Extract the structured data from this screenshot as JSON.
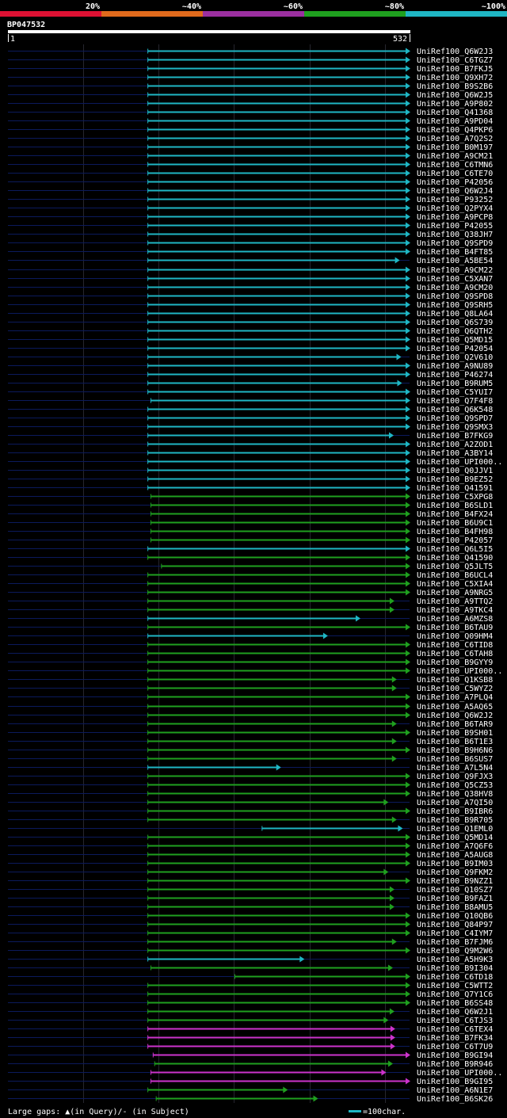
{
  "header": {
    "legend": [
      {
        "label": "20%",
        "color": "#dd1133"
      },
      {
        "label": "~40%",
        "color": "#e06a1c"
      },
      {
        "label": "~60%",
        "color": "#9b2fa0"
      },
      {
        "label": "~80%",
        "color": "#1fa01f"
      },
      {
        "label": "~100%",
        "color": "#1fb6c4"
      }
    ],
    "query_id": "BP047532",
    "start_label": "1",
    "end_label": "532"
  },
  "footer": {
    "gaps_text": "Large gaps: ▲(in Query)/- (in Subject)",
    "scale_text": "=100char."
  },
  "chart_data": {
    "type": "alignment",
    "query_length": 532,
    "colors": {
      "cyan": "#1fb6c4",
      "green": "#1fa01f",
      "magenta": "#cc33cc",
      "navy": "#0b1a5c"
    },
    "hits": [
      {
        "id": "UniRef100_Q6W2J3",
        "start": 186,
        "end": 532,
        "color": "cyan"
      },
      {
        "id": "UniRef100_C6TGZ7",
        "start": 186,
        "end": 532,
        "color": "cyan"
      },
      {
        "id": "UniRef100_B7FKJ5",
        "start": 186,
        "end": 532,
        "color": "cyan"
      },
      {
        "id": "UniRef100_Q9XH72",
        "start": 186,
        "end": 532,
        "color": "cyan"
      },
      {
        "id": "UniRef100_B9S2B6",
        "start": 186,
        "end": 532,
        "color": "cyan"
      },
      {
        "id": "UniRef100_Q6W2J5",
        "start": 186,
        "end": 532,
        "color": "cyan"
      },
      {
        "id": "UniRef100_A9P802",
        "start": 186,
        "end": 532,
        "color": "cyan"
      },
      {
        "id": "UniRef100_Q41368",
        "start": 186,
        "end": 532,
        "color": "cyan"
      },
      {
        "id": "UniRef100_A9PD04",
        "start": 186,
        "end": 532,
        "color": "cyan"
      },
      {
        "id": "UniRef100_Q4PKP6",
        "start": 186,
        "end": 532,
        "color": "cyan"
      },
      {
        "id": "UniRef100_A7Q2S2",
        "start": 186,
        "end": 532,
        "color": "cyan"
      },
      {
        "id": "UniRef100_B0M197",
        "start": 186,
        "end": 532,
        "color": "cyan"
      },
      {
        "id": "UniRef100_A9CM21",
        "start": 186,
        "end": 532,
        "color": "cyan"
      },
      {
        "id": "UniRef100_C6TMN6",
        "start": 186,
        "end": 532,
        "color": "cyan"
      },
      {
        "id": "UniRef100_C6TE70",
        "start": 186,
        "end": 532,
        "color": "cyan"
      },
      {
        "id": "UniRef100_P42056",
        "start": 186,
        "end": 532,
        "color": "cyan"
      },
      {
        "id": "UniRef100_Q6W2J4",
        "start": 186,
        "end": 532,
        "color": "cyan"
      },
      {
        "id": "UniRef100_P93252",
        "start": 186,
        "end": 532,
        "color": "cyan"
      },
      {
        "id": "UniRef100_Q2PYX4",
        "start": 186,
        "end": 532,
        "color": "cyan"
      },
      {
        "id": "UniRef100_A9PCP8",
        "start": 186,
        "end": 532,
        "color": "cyan"
      },
      {
        "id": "UniRef100_P42055",
        "start": 186,
        "end": 532,
        "color": "cyan"
      },
      {
        "id": "UniRef100_Q38JH7",
        "start": 186,
        "end": 532,
        "color": "cyan"
      },
      {
        "id": "UniRef100_Q9SPD9",
        "start": 186,
        "end": 532,
        "color": "cyan"
      },
      {
        "id": "UniRef100_B4FT85",
        "start": 186,
        "end": 532,
        "color": "cyan"
      },
      {
        "id": "UniRef100_A5BE54",
        "start": 186,
        "end": 518,
        "color": "cyan"
      },
      {
        "id": "UniRef100_A9CM22",
        "start": 186,
        "end": 532,
        "color": "cyan"
      },
      {
        "id": "UniRef100_C5XAN7",
        "start": 186,
        "end": 532,
        "color": "cyan"
      },
      {
        "id": "UniRef100_A9CM20",
        "start": 186,
        "end": 532,
        "color": "cyan"
      },
      {
        "id": "UniRef100_Q9SPD8",
        "start": 186,
        "end": 532,
        "color": "cyan"
      },
      {
        "id": "UniRef100_Q9SRH5",
        "start": 186,
        "end": 532,
        "color": "cyan"
      },
      {
        "id": "UniRef100_Q8LA64",
        "start": 186,
        "end": 532,
        "color": "cyan"
      },
      {
        "id": "UniRef100_Q6S739",
        "start": 186,
        "end": 532,
        "color": "cyan"
      },
      {
        "id": "UniRef100_Q6QTH2",
        "start": 186,
        "end": 532,
        "color": "cyan"
      },
      {
        "id": "UniRef100_Q5MD15",
        "start": 186,
        "end": 532,
        "color": "cyan"
      },
      {
        "id": "UniRef100_P42054",
        "start": 186,
        "end": 532,
        "color": "cyan"
      },
      {
        "id": "UniRef100_Q2V610",
        "start": 186,
        "end": 520,
        "color": "cyan"
      },
      {
        "id": "UniRef100_A9NU89",
        "start": 186,
        "end": 532,
        "color": "cyan"
      },
      {
        "id": "UniRef100_P46274",
        "start": 186,
        "end": 532,
        "color": "cyan"
      },
      {
        "id": "UniRef100_B9RUM5",
        "start": 186,
        "end": 521,
        "color": "cyan"
      },
      {
        "id": "UniRef100_C5YUI7",
        "start": 186,
        "end": 532,
        "color": "cyan"
      },
      {
        "id": "UniRef100_Q7F4F8",
        "start": 190,
        "end": 532,
        "color": "cyan"
      },
      {
        "id": "UniRef100_Q6K548",
        "start": 186,
        "end": 532,
        "color": "cyan"
      },
      {
        "id": "UniRef100_Q9SPD7",
        "start": 186,
        "end": 532,
        "color": "cyan"
      },
      {
        "id": "UniRef100_Q9SMX3",
        "start": 186,
        "end": 532,
        "color": "cyan"
      },
      {
        "id": "UniRef100_B7FKG9",
        "start": 186,
        "end": 510,
        "color": "cyan"
      },
      {
        "id": "UniRef100_A2ZOD1",
        "start": 186,
        "end": 532,
        "color": "cyan"
      },
      {
        "id": "UniRef100_A3BY14",
        "start": 186,
        "end": 532,
        "color": "cyan"
      },
      {
        "id": "UniRef100_UPI000..",
        "start": 186,
        "end": 532,
        "color": "cyan"
      },
      {
        "id": "UniRef100_Q0JJV1",
        "start": 186,
        "end": 532,
        "color": "cyan"
      },
      {
        "id": "UniRef100_B9EZ52",
        "start": 186,
        "end": 532,
        "color": "cyan"
      },
      {
        "id": "UniRef100_Q41591",
        "start": 186,
        "end": 532,
        "color": "cyan"
      },
      {
        "id": "UniRef100_C5XPG8",
        "start": 190,
        "end": 532,
        "color": "green"
      },
      {
        "id": "UniRef100_B6SLD1",
        "start": 190,
        "end": 532,
        "color": "green"
      },
      {
        "id": "UniRef100_B4FX24",
        "start": 190,
        "end": 532,
        "color": "green"
      },
      {
        "id": "UniRef100_B6U9C1",
        "start": 190,
        "end": 532,
        "color": "green"
      },
      {
        "id": "UniRef100_B4FH98",
        "start": 190,
        "end": 532,
        "color": "green"
      },
      {
        "id": "UniRef100_P42057",
        "start": 190,
        "end": 532,
        "color": "green"
      },
      {
        "id": "UniRef100_Q6L5I5",
        "start": 186,
        "end": 532,
        "color": "cyan"
      },
      {
        "id": "UniRef100_Q41590",
        "start": 186,
        "end": 532,
        "color": "green"
      },
      {
        "id": "UniRef100_Q5JLT5",
        "start": 204,
        "end": 532,
        "color": "green"
      },
      {
        "id": "UniRef100_B6UCL4",
        "start": 186,
        "end": 532,
        "color": "green"
      },
      {
        "id": "UniRef100_C5XIA4",
        "start": 186,
        "end": 532,
        "color": "green"
      },
      {
        "id": "UniRef100_A9NRG5",
        "start": 186,
        "end": 532,
        "color": "green"
      },
      {
        "id": "UniRef100_A9TTQ2",
        "start": 186,
        "end": 511,
        "color": "green"
      },
      {
        "id": "UniRef100_A9TKC4",
        "start": 186,
        "end": 511,
        "color": "green"
      },
      {
        "id": "UniRef100_A6MZS8",
        "start": 186,
        "end": 466,
        "color": "cyan"
      },
      {
        "id": "UniRef100_B6TAU9",
        "start": 186,
        "end": 532,
        "color": "green"
      },
      {
        "id": "UniRef100_Q09HM4",
        "start": 186,
        "end": 423,
        "color": "cyan"
      },
      {
        "id": "UniRef100_C6TID8",
        "start": 186,
        "end": 532,
        "color": "green"
      },
      {
        "id": "UniRef100_C6TAH8",
        "start": 186,
        "end": 532,
        "color": "green"
      },
      {
        "id": "UniRef100_B9GYY9",
        "start": 186,
        "end": 532,
        "color": "green"
      },
      {
        "id": "UniRef100_UPI000..",
        "start": 186,
        "end": 532,
        "color": "green"
      },
      {
        "id": "UniRef100_Q1KSB8",
        "start": 186,
        "end": 514,
        "color": "green"
      },
      {
        "id": "UniRef100_C5WYZ2",
        "start": 186,
        "end": 514,
        "color": "green"
      },
      {
        "id": "UniRef100_A7PLQ4",
        "start": 186,
        "end": 532,
        "color": "green"
      },
      {
        "id": "UniRef100_A5AQ65",
        "start": 186,
        "end": 532,
        "color": "green"
      },
      {
        "id": "UniRef100_Q6W2J2",
        "start": 186,
        "end": 532,
        "color": "green"
      },
      {
        "id": "UniRef100_B6TAR9",
        "start": 186,
        "end": 514,
        "color": "green"
      },
      {
        "id": "UniRef100_B9SH01",
        "start": 186,
        "end": 532,
        "color": "green"
      },
      {
        "id": "UniRef100_B6T1E3",
        "start": 186,
        "end": 514,
        "color": "green"
      },
      {
        "id": "UniRef100_B9H6N6",
        "start": 186,
        "end": 532,
        "color": "green"
      },
      {
        "id": "UniRef100_B6SUS7",
        "start": 186,
        "end": 514,
        "color": "green"
      },
      {
        "id": "UniRef100_A7L5N4",
        "start": 186,
        "end": 361,
        "color": "cyan"
      },
      {
        "id": "UniRef100_Q9FJX3",
        "start": 186,
        "end": 532,
        "color": "green"
      },
      {
        "id": "UniRef100_Q5CZ53",
        "start": 186,
        "end": 532,
        "color": "green"
      },
      {
        "id": "UniRef100_Q38HV8",
        "start": 186,
        "end": 532,
        "color": "green"
      },
      {
        "id": "UniRef100_A7QI50",
        "start": 186,
        "end": 503,
        "color": "green"
      },
      {
        "id": "UniRef100_B9IBR6",
        "start": 186,
        "end": 532,
        "color": "green"
      },
      {
        "id": "UniRef100_B9R705",
        "start": 186,
        "end": 514,
        "color": "green"
      },
      {
        "id": "UniRef100_Q1EML0",
        "start": 337,
        "end": 522,
        "color": "cyan"
      },
      {
        "id": "UniRef100_Q5MD14",
        "start": 186,
        "end": 532,
        "color": "green"
      },
      {
        "id": "UniRef100_A7Q6F6",
        "start": 186,
        "end": 532,
        "color": "green"
      },
      {
        "id": "UniRef100_A5AUG8",
        "start": 186,
        "end": 532,
        "color": "green"
      },
      {
        "id": "UniRef100_B9IM03",
        "start": 186,
        "end": 532,
        "color": "green"
      },
      {
        "id": "UniRef100_Q9FKM2",
        "start": 186,
        "end": 503,
        "color": "green"
      },
      {
        "id": "UniRef100_B9NZZ1",
        "start": 186,
        "end": 532,
        "color": "green"
      },
      {
        "id": "UniRef100_Q10SZ7",
        "start": 186,
        "end": 511,
        "color": "green"
      },
      {
        "id": "UniRef100_B9FAZ1",
        "start": 186,
        "end": 511,
        "color": "green"
      },
      {
        "id": "UniRef100_B8AMU5",
        "start": 186,
        "end": 511,
        "color": "green"
      },
      {
        "id": "UniRef100_Q10QB6",
        "start": 186,
        "end": 532,
        "color": "green"
      },
      {
        "id": "UniRef100_Q84P97",
        "start": 186,
        "end": 532,
        "color": "green"
      },
      {
        "id": "UniRef100_C4IYM7",
        "start": 186,
        "end": 532,
        "color": "green"
      },
      {
        "id": "UniRef100_B7FJM6",
        "start": 186,
        "end": 514,
        "color": "green"
      },
      {
        "id": "UniRef100_Q9M2W6",
        "start": 186,
        "end": 532,
        "color": "green"
      },
      {
        "id": "UniRef100_A5H9K3",
        "start": 186,
        "end": 392,
        "color": "cyan"
      },
      {
        "id": "UniRef100_B9I304",
        "start": 190,
        "end": 509,
        "color": "green"
      },
      {
        "id": "UniRef100_C6TD18",
        "start": 301,
        "end": 532,
        "color": "green"
      },
      {
        "id": "UniRef100_C5WTT2",
        "start": 186,
        "end": 532,
        "color": "green"
      },
      {
        "id": "UniRef100_Q7Y1C6",
        "start": 186,
        "end": 532,
        "color": "green"
      },
      {
        "id": "UniRef100_B6SS48",
        "start": 186,
        "end": 532,
        "color": "green"
      },
      {
        "id": "UniRef100_Q6W2J1",
        "start": 186,
        "end": 511,
        "color": "green"
      },
      {
        "id": "UniRef100_C6TJS3",
        "start": 186,
        "end": 503,
        "color": "green"
      },
      {
        "id": "UniRef100_C6TEX4",
        "start": 186,
        "end": 512,
        "color": "magenta"
      },
      {
        "id": "UniRef100_B7FK34",
        "start": 186,
        "end": 512,
        "color": "magenta"
      },
      {
        "id": "UniRef100_C6T7U9",
        "start": 186,
        "end": 512,
        "color": "magenta"
      },
      {
        "id": "UniRef100_B9GI94",
        "start": 193,
        "end": 532,
        "color": "magenta"
      },
      {
        "id": "UniRef100_B9R946",
        "start": 195,
        "end": 509,
        "color": "green"
      },
      {
        "id": "UniRef100_UPI000..",
        "start": 190,
        "end": 500,
        "color": "magenta"
      },
      {
        "id": "UniRef100_B9GI95",
        "start": 190,
        "end": 532,
        "color": "magenta"
      },
      {
        "id": "UniRef100_A6N1E7",
        "start": 186,
        "end": 370,
        "color": "green"
      },
      {
        "id": "UniRef100_B6SK26",
        "start": 197,
        "end": 410,
        "color": "green"
      }
    ]
  }
}
